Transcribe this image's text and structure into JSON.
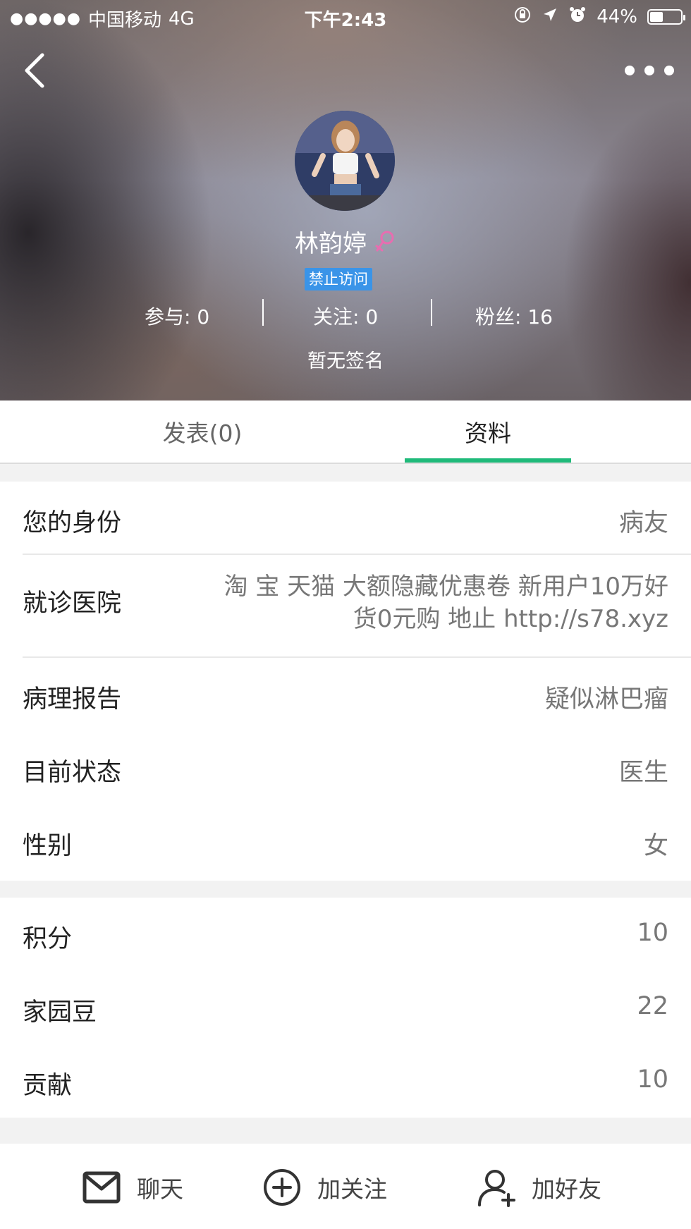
{
  "status_bar": {
    "signal": "●●●●●",
    "carrier": "中国移动",
    "network": "4G",
    "time": "下午2:43",
    "battery_percent": "44%",
    "battery_level": 0.44
  },
  "profile": {
    "username": "林韵婷",
    "gender_icon": "female-symbol-icon",
    "badge": "禁止访问",
    "stats": {
      "participate": "参与: 0",
      "following": "关注: 0",
      "fans": "粉丝: 16"
    },
    "signature": "暂无签名"
  },
  "tabs": [
    {
      "label": "发表(0)",
      "active": false
    },
    {
      "label": "资料",
      "active": true
    }
  ],
  "info": {
    "identity": {
      "label": "您的身份",
      "value": "病友"
    },
    "hospital": {
      "label": "就诊医院",
      "value_line1": "淘 宝 天猫 大额隐藏优惠卷 新用户10万好",
      "value_line2": "货0元购 地止 http://s78.xyz"
    },
    "pathology": {
      "label": "病理报告",
      "value": "疑似淋巴瘤"
    },
    "status": {
      "label": "目前状态",
      "value": "医生"
    },
    "gender": {
      "label": "性别",
      "value": "女"
    }
  },
  "stats_section": {
    "points": {
      "label": "积分",
      "value": "10"
    },
    "beans": {
      "label": "家园豆",
      "value": "22"
    },
    "contribution": {
      "label": "贡献",
      "value": "10"
    }
  },
  "bottom_bar": {
    "chat": "聊天",
    "follow": "加关注",
    "add_friend": "加好友"
  },
  "colors": {
    "accent": "#1fba7a",
    "badge": "#3a94e8",
    "gender": "#e86db0"
  }
}
